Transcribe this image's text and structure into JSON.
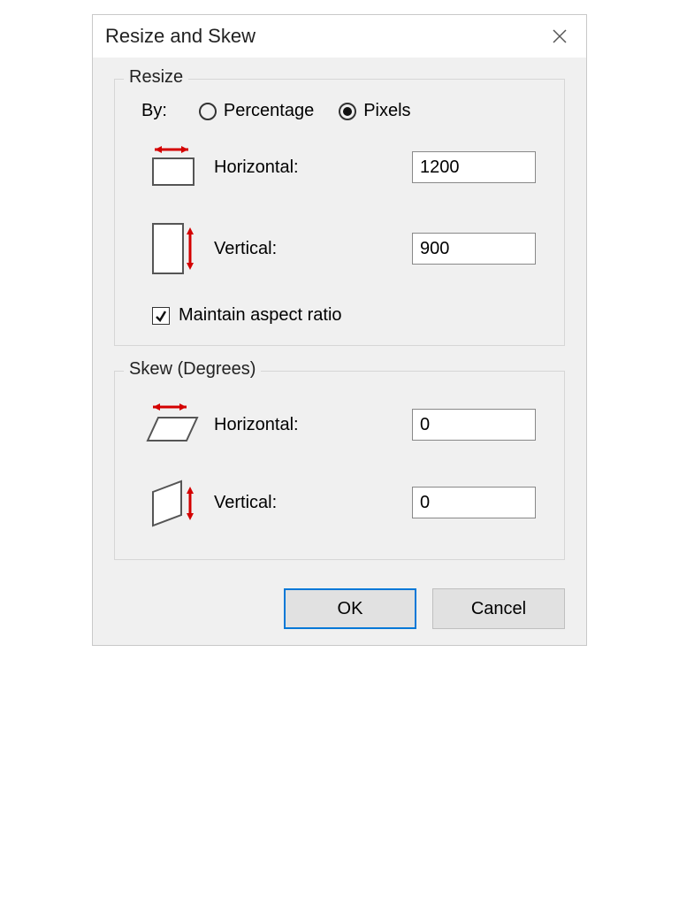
{
  "window": {
    "title": "Resize and Skew"
  },
  "resize": {
    "legend": "Resize",
    "by_label": "By:",
    "percentage_label": "Percentage",
    "pixels_label": "Pixels",
    "selected_mode": "pixels",
    "horizontal_label": "Horizontal:",
    "horizontal_value": "1200",
    "vertical_label": "Vertical:",
    "vertical_value": "900",
    "maintain_label": "Maintain aspect ratio",
    "maintain_checked": true
  },
  "skew": {
    "legend": "Skew (Degrees)",
    "horizontal_label": "Horizontal:",
    "horizontal_value": "0",
    "vertical_label": "Vertical:",
    "vertical_value": "0"
  },
  "buttons": {
    "ok": "OK",
    "cancel": "Cancel"
  }
}
